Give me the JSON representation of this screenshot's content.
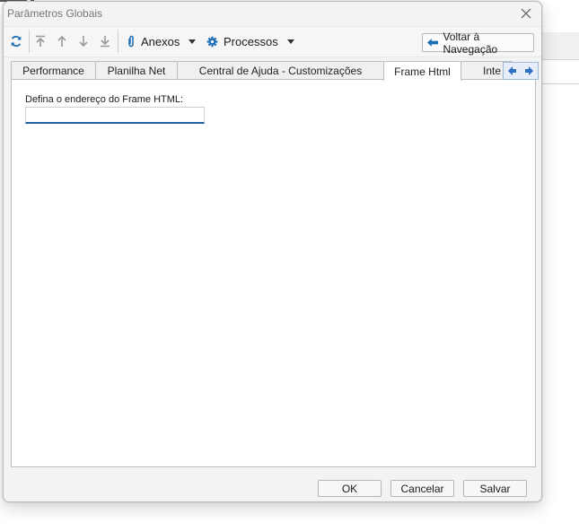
{
  "window": {
    "title": "Parâmetros Globais"
  },
  "toolbar": {
    "refresh_icon": "refresh-icon",
    "move_first_icon": "arrow-to-top-icon",
    "move_up_icon": "arrow-up-icon",
    "move_down_icon": "arrow-down-icon",
    "move_last_icon": "arrow-to-bottom-icon",
    "attachments_label": "Anexos",
    "processes_label": "Processos",
    "back_nav_label": "Voltar à Navegação"
  },
  "tabs": [
    {
      "label": "Performance",
      "active": false
    },
    {
      "label": "Planilha Net",
      "active": false
    },
    {
      "label": "Central de Ajuda - Customizações",
      "active": false
    },
    {
      "label": "Frame Html",
      "active": true
    },
    {
      "label": "Inte",
      "active": false
    }
  ],
  "frame_html": {
    "field_label": "Defina o endereço do Frame HTML:",
    "field_value": ""
  },
  "footer": {
    "ok_label": "OK",
    "cancel_label": "Cancelar",
    "save_label": "Salvar"
  },
  "colors": {
    "accent": "#1f5fa8",
    "icon_blue": "#1f6fb5",
    "disabled_icon": "#9a9a9a"
  }
}
